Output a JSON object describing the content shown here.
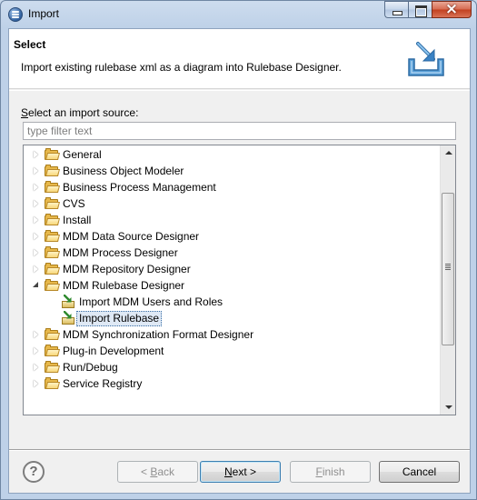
{
  "window": {
    "title": "Import"
  },
  "banner": {
    "title": "Select",
    "description": "Import existing rulebase xml as a diagram into Rulebase Designer."
  },
  "source": {
    "label_mnemonic": "S",
    "label_rest": "elect an import source:",
    "filter_placeholder": "type filter text"
  },
  "tree": {
    "items": [
      {
        "label": "General",
        "level": 0,
        "type": "folder",
        "expanded": false
      },
      {
        "label": "Business Object Modeler",
        "level": 0,
        "type": "folder",
        "expanded": false
      },
      {
        "label": "Business Process Management",
        "level": 0,
        "type": "folder",
        "expanded": false
      },
      {
        "label": "CVS",
        "level": 0,
        "type": "folder",
        "expanded": false
      },
      {
        "label": "Install",
        "level": 0,
        "type": "folder",
        "expanded": false
      },
      {
        "label": "MDM Data Source Designer",
        "level": 0,
        "type": "folder",
        "expanded": false
      },
      {
        "label": "MDM Process Designer",
        "level": 0,
        "type": "folder",
        "expanded": false
      },
      {
        "label": "MDM Repository Designer",
        "level": 0,
        "type": "folder",
        "expanded": false
      },
      {
        "label": "MDM Rulebase Designer",
        "level": 0,
        "type": "folder",
        "expanded": true
      },
      {
        "label": "Import MDM Users and Roles",
        "level": 1,
        "type": "wizard"
      },
      {
        "label": "Import Rulebase",
        "level": 1,
        "type": "wizard",
        "selected": true
      },
      {
        "label": "MDM Synchronization Format Designer",
        "level": 0,
        "type": "folder",
        "expanded": false
      },
      {
        "label": "Plug-in Development",
        "level": 0,
        "type": "folder",
        "expanded": false
      },
      {
        "label": "Run/Debug",
        "level": 0,
        "type": "folder",
        "expanded": false
      },
      {
        "label": "Service Registry",
        "level": 0,
        "type": "folder",
        "expanded": false
      }
    ]
  },
  "buttons": {
    "help": "?",
    "back_prefix": "< ",
    "back_mnemonic": "B",
    "back_rest": "ack",
    "next_mnemonic": "N",
    "next_rest": "ext >",
    "finish_mnemonic": "F",
    "finish_rest": "inish",
    "cancel": "Cancel"
  },
  "colors": {
    "selection_bg": "#dfe9f5",
    "folder": "#e7b84b"
  }
}
